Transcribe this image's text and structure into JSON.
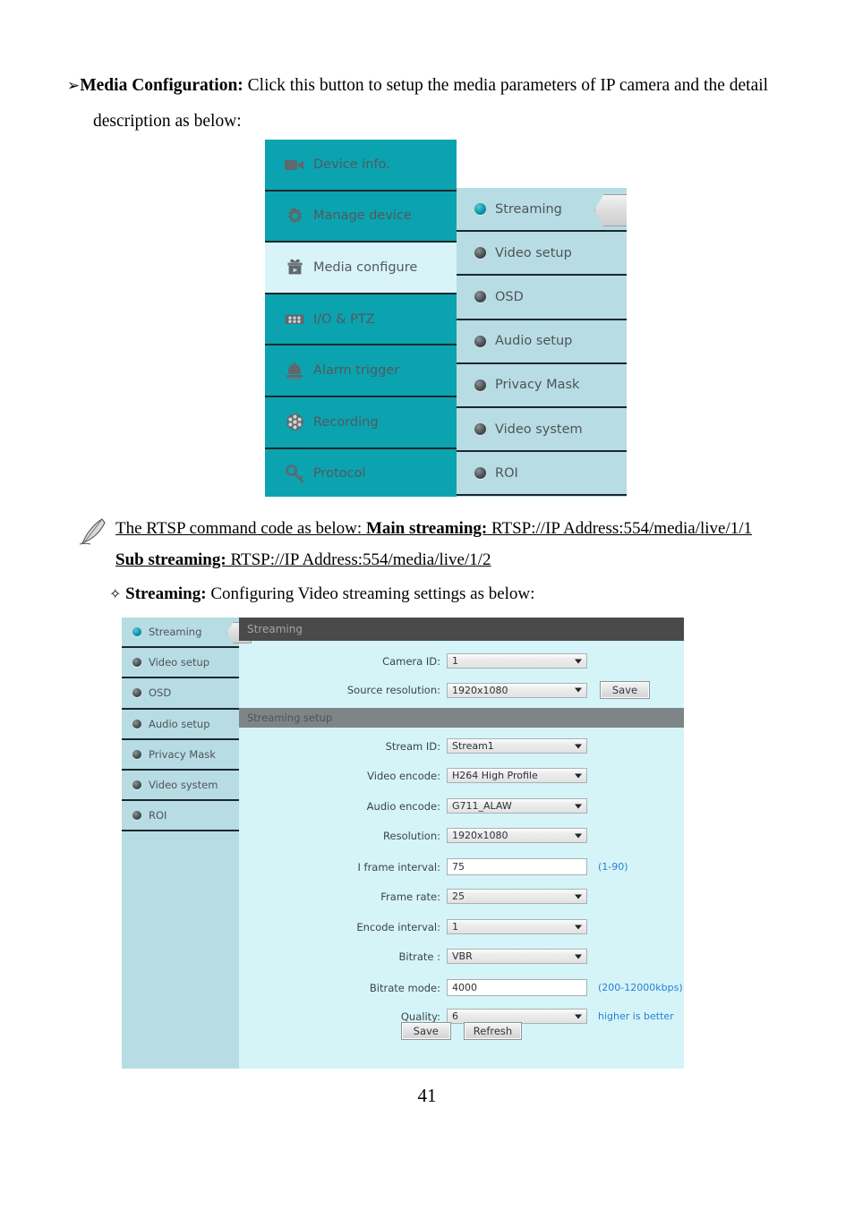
{
  "document": {
    "bullet_marker": "➢",
    "para1_bold": "Media Configuration:",
    "para1_rest": " Click this button to setup the media parameters of IP camera and the detail",
    "para1_line2": "description as below:",
    "note_prefix": "The RTSP command code as below: ",
    "note_main_label": "Main streaming:",
    "note_main_value": " RTSP://IP Address:554/media/live/1/1",
    "note_sub_label": "Sub streaming:",
    "note_sub_value": " RTSP://IP Address:554/media/live/1/2",
    "diamond_marker": "✧",
    "streaming_head_bold": "Streaming:",
    "streaming_head_rest": " Configuring Video streaming settings as below:",
    "page_number": "41"
  },
  "colors": {
    "teal": "#0ba3b0",
    "light_teal": "#b8dce3",
    "panel": "#d4f4f8",
    "header_dark": "#4a4a4a",
    "header_gray": "#7f8487",
    "hint_blue": "#2b7fd4",
    "active_row": "#d8f4f8"
  },
  "figure_menu": {
    "primary_menu": [
      {
        "label": "Device info.",
        "icon": "camcorder-icon",
        "active": false
      },
      {
        "label": "Manage device",
        "icon": "gear-icon",
        "active": false
      },
      {
        "label": "Media configure",
        "icon": "media-box-icon",
        "active": true
      },
      {
        "label": "I/O & PTZ",
        "icon": "io-module-icon",
        "active": false
      },
      {
        "label": "Alarm trigger",
        "icon": "alarm-bell-icon",
        "active": false
      },
      {
        "label": "Recording",
        "icon": "film-reel-icon",
        "active": false
      },
      {
        "label": "Protocol",
        "icon": "key-icon",
        "active": false
      }
    ],
    "submenu": [
      {
        "label": "Streaming",
        "selected": true
      },
      {
        "label": "Video setup",
        "selected": false
      },
      {
        "label": "OSD",
        "selected": false
      },
      {
        "label": "Audio setup",
        "selected": false
      },
      {
        "label": "Privacy Mask",
        "selected": false
      },
      {
        "label": "Video system",
        "selected": false
      },
      {
        "label": "ROI",
        "selected": false
      }
    ]
  },
  "figure_streaming": {
    "sidebar": [
      {
        "label": "Streaming",
        "selected": true
      },
      {
        "label": "Video setup",
        "selected": false
      },
      {
        "label": "OSD",
        "selected": false
      },
      {
        "label": "Audio setup",
        "selected": false
      },
      {
        "label": "Privacy Mask",
        "selected": false
      },
      {
        "label": "Video system",
        "selected": false
      },
      {
        "label": "ROI",
        "selected": false
      }
    ],
    "section_streaming": {
      "title": "Streaming",
      "camera_id_label": "Camera ID:",
      "camera_id_value": "1",
      "source_resolution_label": "Source resolution:",
      "source_resolution_value": "1920x1080",
      "save_label": "Save"
    },
    "section_streaming_setup": {
      "title": "Streaming setup",
      "fields": [
        {
          "label": "Stream ID:",
          "value": "Stream1",
          "type": "select",
          "hint": ""
        },
        {
          "label": "Video encode:",
          "value": "H264 High Profile",
          "type": "select",
          "hint": ""
        },
        {
          "label": "Audio encode:",
          "value": "G711_ALAW",
          "type": "select",
          "hint": ""
        },
        {
          "label": "Resolution:",
          "value": "1920x1080",
          "type": "select",
          "hint": ""
        },
        {
          "label": "I frame interval:",
          "value": "75",
          "type": "text",
          "hint": "(1-90)"
        },
        {
          "label": "Frame rate:",
          "value": "25",
          "type": "select",
          "hint": ""
        },
        {
          "label": "Encode interval:",
          "value": "1",
          "type": "select",
          "hint": ""
        },
        {
          "label": "Bitrate :",
          "value": "VBR",
          "type": "select",
          "hint": ""
        },
        {
          "label": "Bitrate mode:",
          "value": "4000",
          "type": "text",
          "hint": "(200-12000kbps)"
        },
        {
          "label": "Quality:",
          "value": "6",
          "type": "select",
          "hint": "higher is better"
        }
      ],
      "save_label": "Save",
      "refresh_label": "Refresh"
    }
  }
}
